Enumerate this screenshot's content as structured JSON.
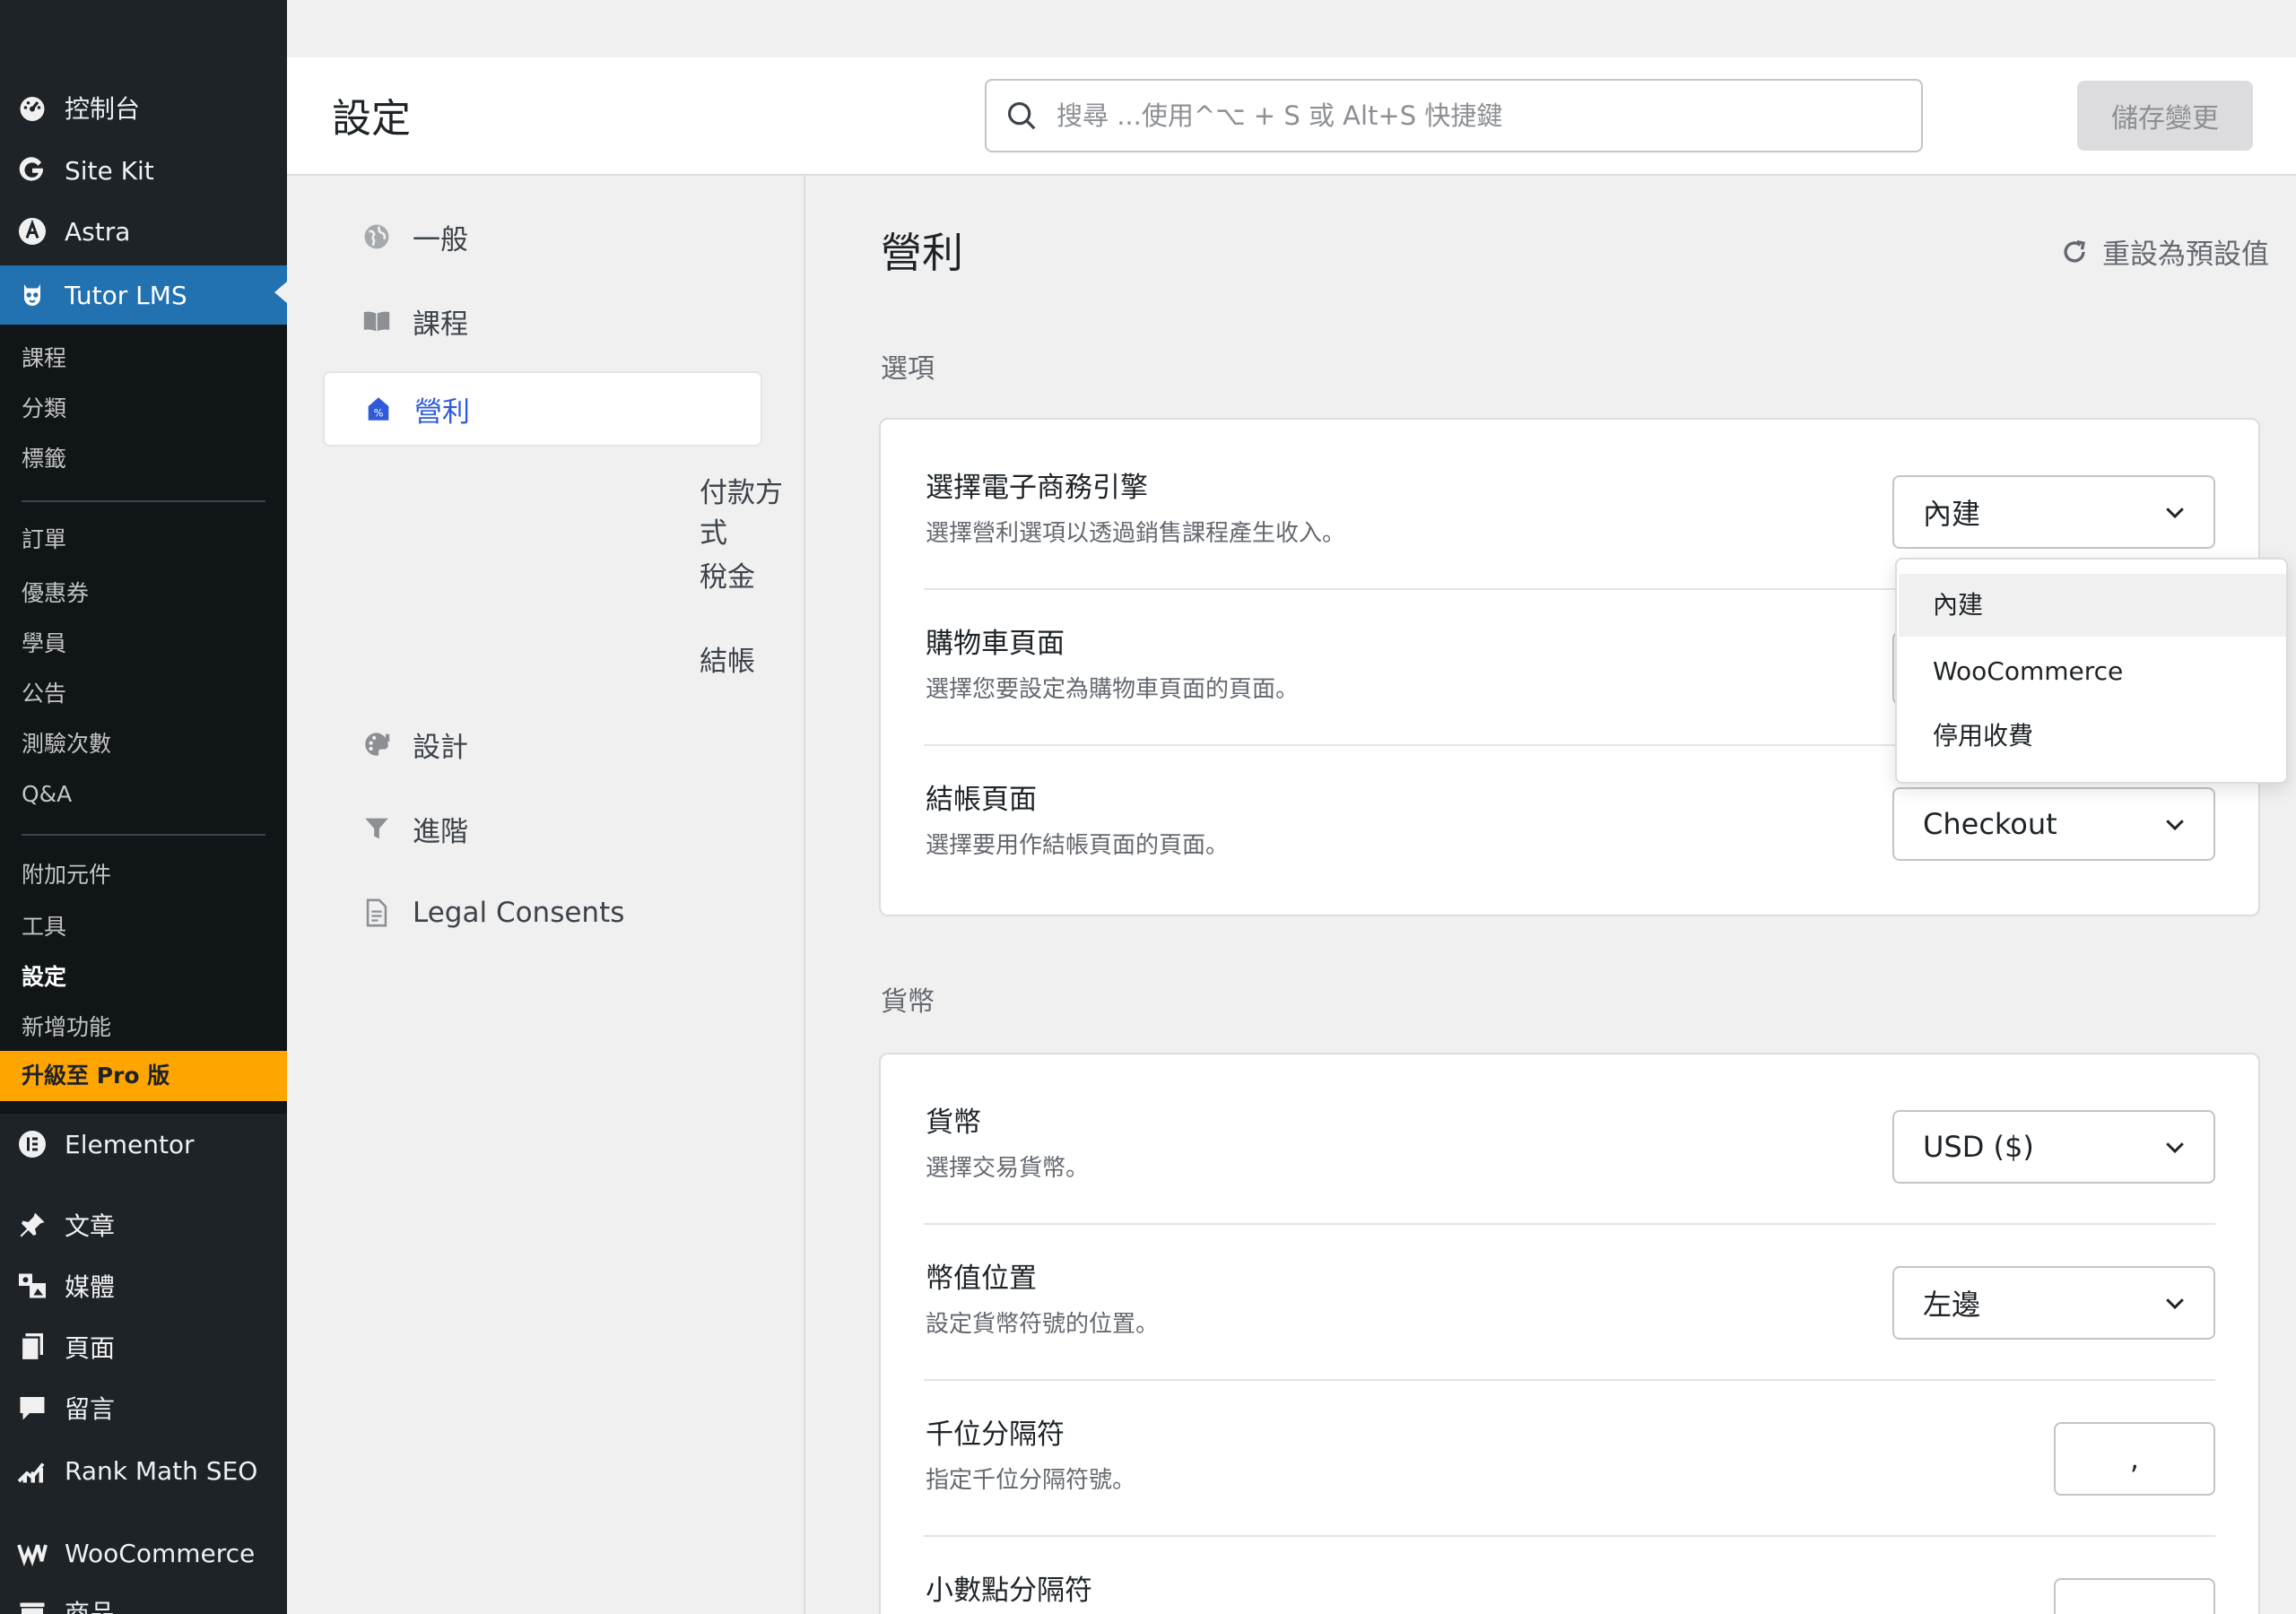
{
  "admin_menu": {
    "top_items": [
      {
        "label": "控制台",
        "icon": "dashboard-icon"
      },
      {
        "label": "Site Kit",
        "icon": "google-g-icon"
      },
      {
        "label": "Astra",
        "icon": "astra-icon"
      },
      {
        "label": "Tutor LMS",
        "icon": "tutor-owl-icon"
      }
    ],
    "tutor_submenu": [
      "課程",
      "分類",
      "標籤",
      "訂單",
      "優惠券",
      "學員",
      "公告",
      "測驗次數",
      "Q&A",
      "附加元件",
      "工具",
      "設定",
      "新增功能"
    ],
    "upgrade_label": "升級至 Pro 版",
    "bottom_items": [
      {
        "label": "Elementor",
        "icon": "elementor-icon"
      },
      {
        "label": "文章",
        "icon": "pin-icon"
      },
      {
        "label": "媒體",
        "icon": "media-icon"
      },
      {
        "label": "頁面",
        "icon": "pages-icon"
      },
      {
        "label": "留言",
        "icon": "comment-icon"
      },
      {
        "label": "Rank Math SEO",
        "icon": "rank-math-icon"
      },
      {
        "label": "WooCommerce",
        "icon": "woocommerce-icon"
      },
      {
        "label": "商品",
        "icon": "products-icon"
      }
    ]
  },
  "header": {
    "title": "設定",
    "search_placeholder": "搜尋 ...使用^⌥ + S 或 Alt+S 快捷鍵",
    "save_label": "儲存變更"
  },
  "settings_nav": {
    "items": [
      {
        "label": "一般",
        "icon": "globe-icon"
      },
      {
        "label": "課程",
        "icon": "book-icon"
      },
      {
        "label": "營利",
        "icon": "monetization-icon",
        "active": true
      },
      {
        "label": "設計",
        "icon": "palette-icon"
      },
      {
        "label": "進階",
        "icon": "filter-icon"
      },
      {
        "label": "Legal Consents",
        "icon": "document-icon"
      }
    ],
    "sub_items": [
      "付款方式",
      "稅金",
      "結帳"
    ]
  },
  "main": {
    "section_title": "營利",
    "reset_label": "重設為預設值",
    "options_group": {
      "title": "選項",
      "rows": [
        {
          "label": "選擇電子商務引擎",
          "desc": "選擇營利選項以透過銷售課程產生收入。",
          "value": "內建"
        },
        {
          "label": "購物車頁面",
          "desc": "選擇您要設定為購物車頁面的頁面。",
          "value": ""
        },
        {
          "label": "結帳頁面",
          "desc": "選擇要用作結帳頁面的頁面。",
          "value": "Checkout"
        }
      ]
    },
    "currency_group": {
      "title": "貨幣",
      "rows": [
        {
          "label": "貨幣",
          "desc": "選擇交易貨幣。",
          "value": "USD ($)"
        },
        {
          "label": "幣值位置",
          "desc": "設定貨幣符號的位置。",
          "value": "左邊"
        },
        {
          "label": "千位分隔符",
          "desc": "指定千位分隔符號。",
          "value": ","
        },
        {
          "label": "小數點分隔符",
          "desc": "",
          "value": ""
        }
      ]
    }
  },
  "dropdown": {
    "options": [
      "內建",
      "WooCommerce",
      "停用收費"
    ],
    "selected_index": 0
  },
  "colors": {
    "wp_sidebar": "#1d2327",
    "wp_active": "#2271b1",
    "upgrade": "#ffa500",
    "accent": "#2f5ad8"
  }
}
